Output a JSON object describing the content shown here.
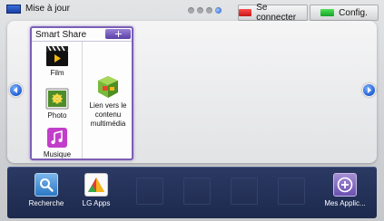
{
  "top_bar": {
    "update_label": "Mise à jour",
    "connect_label": "Se connecter",
    "config_label": "Config.",
    "page_count": 4,
    "active_page": 4
  },
  "smart_share": {
    "title": "Smart Share",
    "items": [
      {
        "label": "Film",
        "icon": "film-icon"
      },
      {
        "label": "Photo",
        "icon": "photo-icon"
      },
      {
        "label": "Musique",
        "icon": "music-icon"
      },
      {
        "label": "Lien vers le contenu multimédia",
        "icon": "media-link-icon"
      }
    ]
  },
  "dock": {
    "apps": [
      {
        "label": "Recherche",
        "icon": "search-icon"
      },
      {
        "label": "LG Apps",
        "icon": "lg-apps-icon"
      },
      {
        "label": "Mes Applic...",
        "icon": "add-app-icon"
      }
    ]
  },
  "colors": {
    "accent_purple": "#7b5fb5",
    "dock_navy": "#1d2a4e",
    "red_button": "#c51616",
    "green_button": "#15a227",
    "arrow_blue": "#1f5fd4"
  }
}
